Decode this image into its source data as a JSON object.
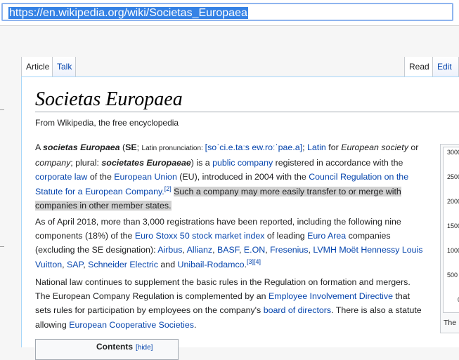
{
  "browser": {
    "url": "https://en.wikipedia.org/wiki/Societas_Europaea"
  },
  "tabs": {
    "article": "Article",
    "talk": "Talk",
    "read": "Read",
    "edit": "Edit"
  },
  "article": {
    "title": "Societas Europaea",
    "tagline": "From Wikipedia, the free encyclopedia",
    "p1": {
      "t1": "A ",
      "term1": "societas Europaea",
      "t2": " (",
      "se": "SE",
      "t3": "; ",
      "latin_pron": "Latin pronunciation: ",
      "ipa": "[soˈci.e.taːs ew.roːˈpae.a]",
      "t4": "; ",
      "latin": "Latin",
      "t5": " for ",
      "eu_society": "European society",
      "t6": " or ",
      "company": "company",
      "t7": "; plural: ",
      "term2": "societates Europaeae",
      "t8": ") is a ",
      "public_company": "public company",
      "t9": " registered in accordance with the ",
      "corporate_law": "corporate law",
      "t10": " of the ",
      "eu": "European Union",
      "t11": " (EU), introduced in 2004 with the ",
      "council_reg": "Council Regulation on the Statute for a European Company.",
      "ref2": "[2]",
      "t12": " ",
      "highlight": "Such a company may more easily transfer to or merge with companies in other member states."
    },
    "p2": {
      "t1": "As of April 2018, more than 3,000 registrations have been reported, including the following nine components (18%) of the ",
      "euro_stoxx": "Euro Stoxx 50 stock market index",
      "t2": " of leading ",
      "euro_area": "Euro Area",
      "t3": " companies (excluding the SE designation): ",
      "airbus": "Airbus",
      "sep1": ", ",
      "allianz": "Allianz",
      "sep2": ", ",
      "basf": "BASF",
      "sep3": ", ",
      "eon": "E.ON",
      "sep4": ", ",
      "fresenius": "Fresenius",
      "sep5": ", ",
      "lvmh": "LVMH Moët Hennessy Louis Vuitton",
      "sep6": ", ",
      "sap": "SAP",
      "sep7": ", ",
      "schneider": "Schneider Electric",
      "t4": " and ",
      "unibail": "Unibail-Rodamco",
      "t5": ".",
      "refs": "[3][4]"
    },
    "p3": {
      "t1": "National law continues to supplement the basic rules in the Regulation on formation and mergers. The European Company Regulation is complemented by an ",
      "eid": "Employee Involvement Directive",
      "t2": " that sets rules for participation by employees on the company's ",
      "board": "board of directors",
      "t3": ". There is also a statute allowing ",
      "ecs": "European Cooperative Societies",
      "t4": "."
    },
    "toc": {
      "title": "Contents",
      "hide": "[hide]"
    },
    "chart": {
      "ticks": [
        "3000",
        "2500",
        "2000",
        "1500",
        "1000",
        "500",
        "0"
      ],
      "caption": "The"
    }
  }
}
